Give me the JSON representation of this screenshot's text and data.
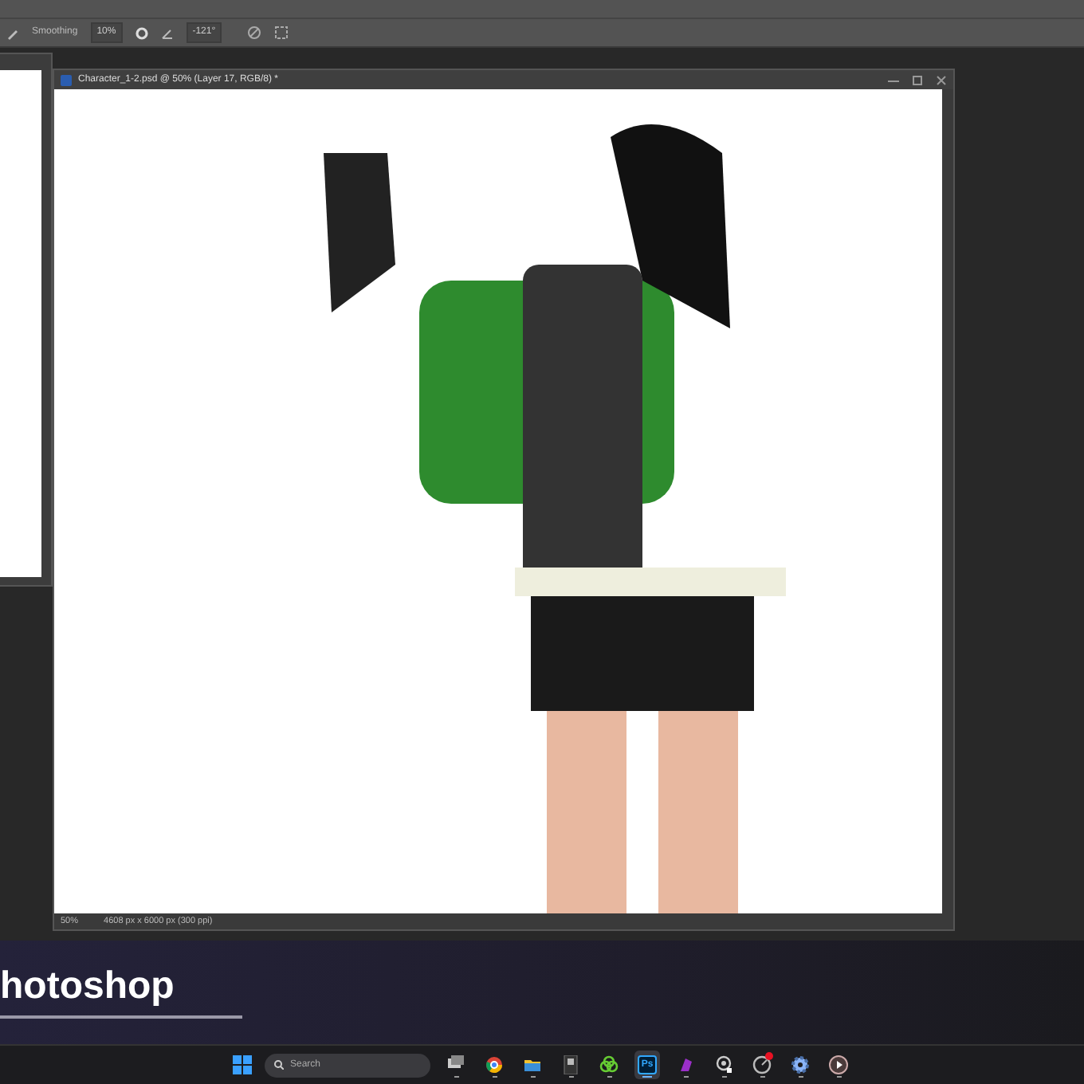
{
  "options_bar": {
    "smoothing_label": "Smoothing",
    "smoothing_value": "10%",
    "angle_value": "-121°"
  },
  "document": {
    "title": "Character_1-2.psd @ 50% (Layer 17, RGB/8) *",
    "zoom": "50%",
    "dimensions": "4608 px x 6000 px (300 ppi)"
  },
  "caption": "hotoshop",
  "taskbar": {
    "search_placeholder": "Search",
    "apps": [
      {
        "kind": "taskview",
        "selected": false,
        "badge": false
      },
      {
        "kind": "browser",
        "selected": false,
        "badge": false
      },
      {
        "kind": "folder",
        "selected": false,
        "badge": false
      },
      {
        "kind": "launcher",
        "selected": false,
        "badge": false
      },
      {
        "kind": "cloud",
        "selected": false,
        "badge": false
      },
      {
        "kind": "ps",
        "label": "Ps",
        "selected": true,
        "badge": false
      },
      {
        "kind": "purple",
        "selected": false,
        "badge": false
      },
      {
        "kind": "pin",
        "selected": false,
        "badge": false
      },
      {
        "kind": "dial",
        "selected": false,
        "badge": true
      },
      {
        "kind": "gear",
        "selected": false,
        "badge": false
      },
      {
        "kind": "play",
        "selected": false,
        "badge": false
      }
    ]
  }
}
